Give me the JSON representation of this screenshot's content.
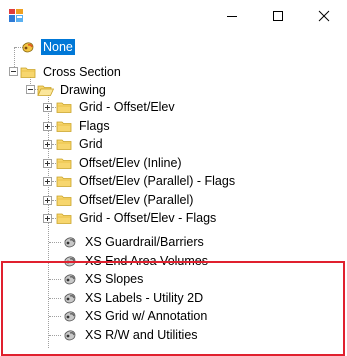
{
  "window": {
    "icons": {
      "app": "app-icon",
      "minimize": "minimize-icon",
      "maximize": "maximize-icon",
      "close": "close-icon"
    }
  },
  "tree": {
    "root_item": {
      "label": "None",
      "selected": true,
      "icon": "style-icon"
    },
    "cross_section": {
      "label": "Cross Section",
      "expanded": true,
      "icon": "folder-icon"
    },
    "drawing": {
      "label": "Drawing",
      "expanded": true,
      "icon": "folder-open-icon"
    },
    "drawing_folders": [
      {
        "label": "Grid - Offset/Elev"
      },
      {
        "label": "Flags"
      },
      {
        "label": "Grid"
      },
      {
        "label": "Offset/Elev (Inline)"
      },
      {
        "label": "Offset/Elev (Parallel) - Flags"
      },
      {
        "label": "Offset/Elev (Parallel)"
      },
      {
        "label": "Grid - Offset/Elev - Flags"
      }
    ],
    "drawing_styles": [
      {
        "label": "XS Guardrail/Barriers"
      },
      {
        "label": "XS End Area Volumes"
      },
      {
        "label": "XS Slopes"
      },
      {
        "label": "XS Labels - Utility 2D"
      },
      {
        "label": "XS Grid w/ Annotation"
      },
      {
        "label": "XS R/W and Utilities"
      }
    ],
    "highlight_color": "#e0202e",
    "selection_color": "#0078d7"
  }
}
